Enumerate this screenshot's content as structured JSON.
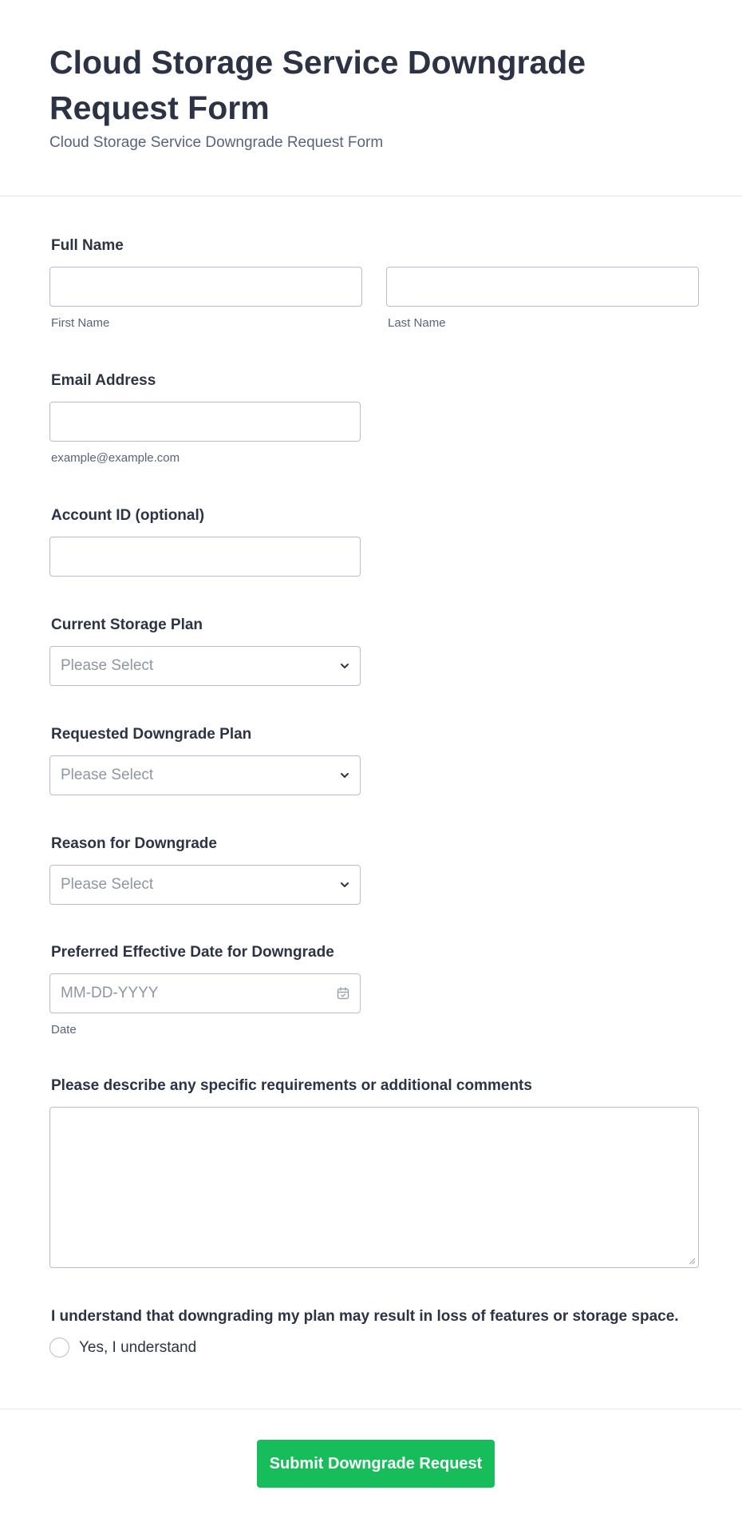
{
  "form": {
    "title": "Cloud Storage Service Downgrade Request Form",
    "subtitle": "Cloud Storage Service Downgrade Request Form"
  },
  "fields": {
    "full_name": {
      "label": "Full Name",
      "first_sublabel": "First Name",
      "last_sublabel": "Last Name",
      "first_value": "",
      "last_value": ""
    },
    "email": {
      "label": "Email Address",
      "sublabel": "example@example.com",
      "value": ""
    },
    "account_id": {
      "label": "Account ID (optional)",
      "value": ""
    },
    "current_plan": {
      "label": "Current Storage Plan",
      "selected": "Please Select"
    },
    "requested_plan": {
      "label": "Requested Downgrade Plan",
      "selected": "Please Select"
    },
    "reason": {
      "label": "Reason for Downgrade",
      "selected": "Please Select"
    },
    "effective_date": {
      "label": "Preferred Effective Date for Downgrade",
      "placeholder": "MM-DD-YYYY",
      "sublabel": "Date"
    },
    "comments": {
      "label": "Please describe any specific requirements or additional comments",
      "value": ""
    },
    "acknowledge": {
      "label": "I understand that downgrading my plan may result in loss of features or storage space.",
      "option": "Yes, I understand"
    }
  },
  "submit": {
    "label": "Submit Downgrade Request"
  },
  "colors": {
    "accent": "#18bd5b",
    "text": "#2c3345",
    "muted": "#57647e",
    "border": "#b8bdc9"
  },
  "icons": {
    "select": "chevron-down-icon",
    "date": "calendar-icon"
  }
}
